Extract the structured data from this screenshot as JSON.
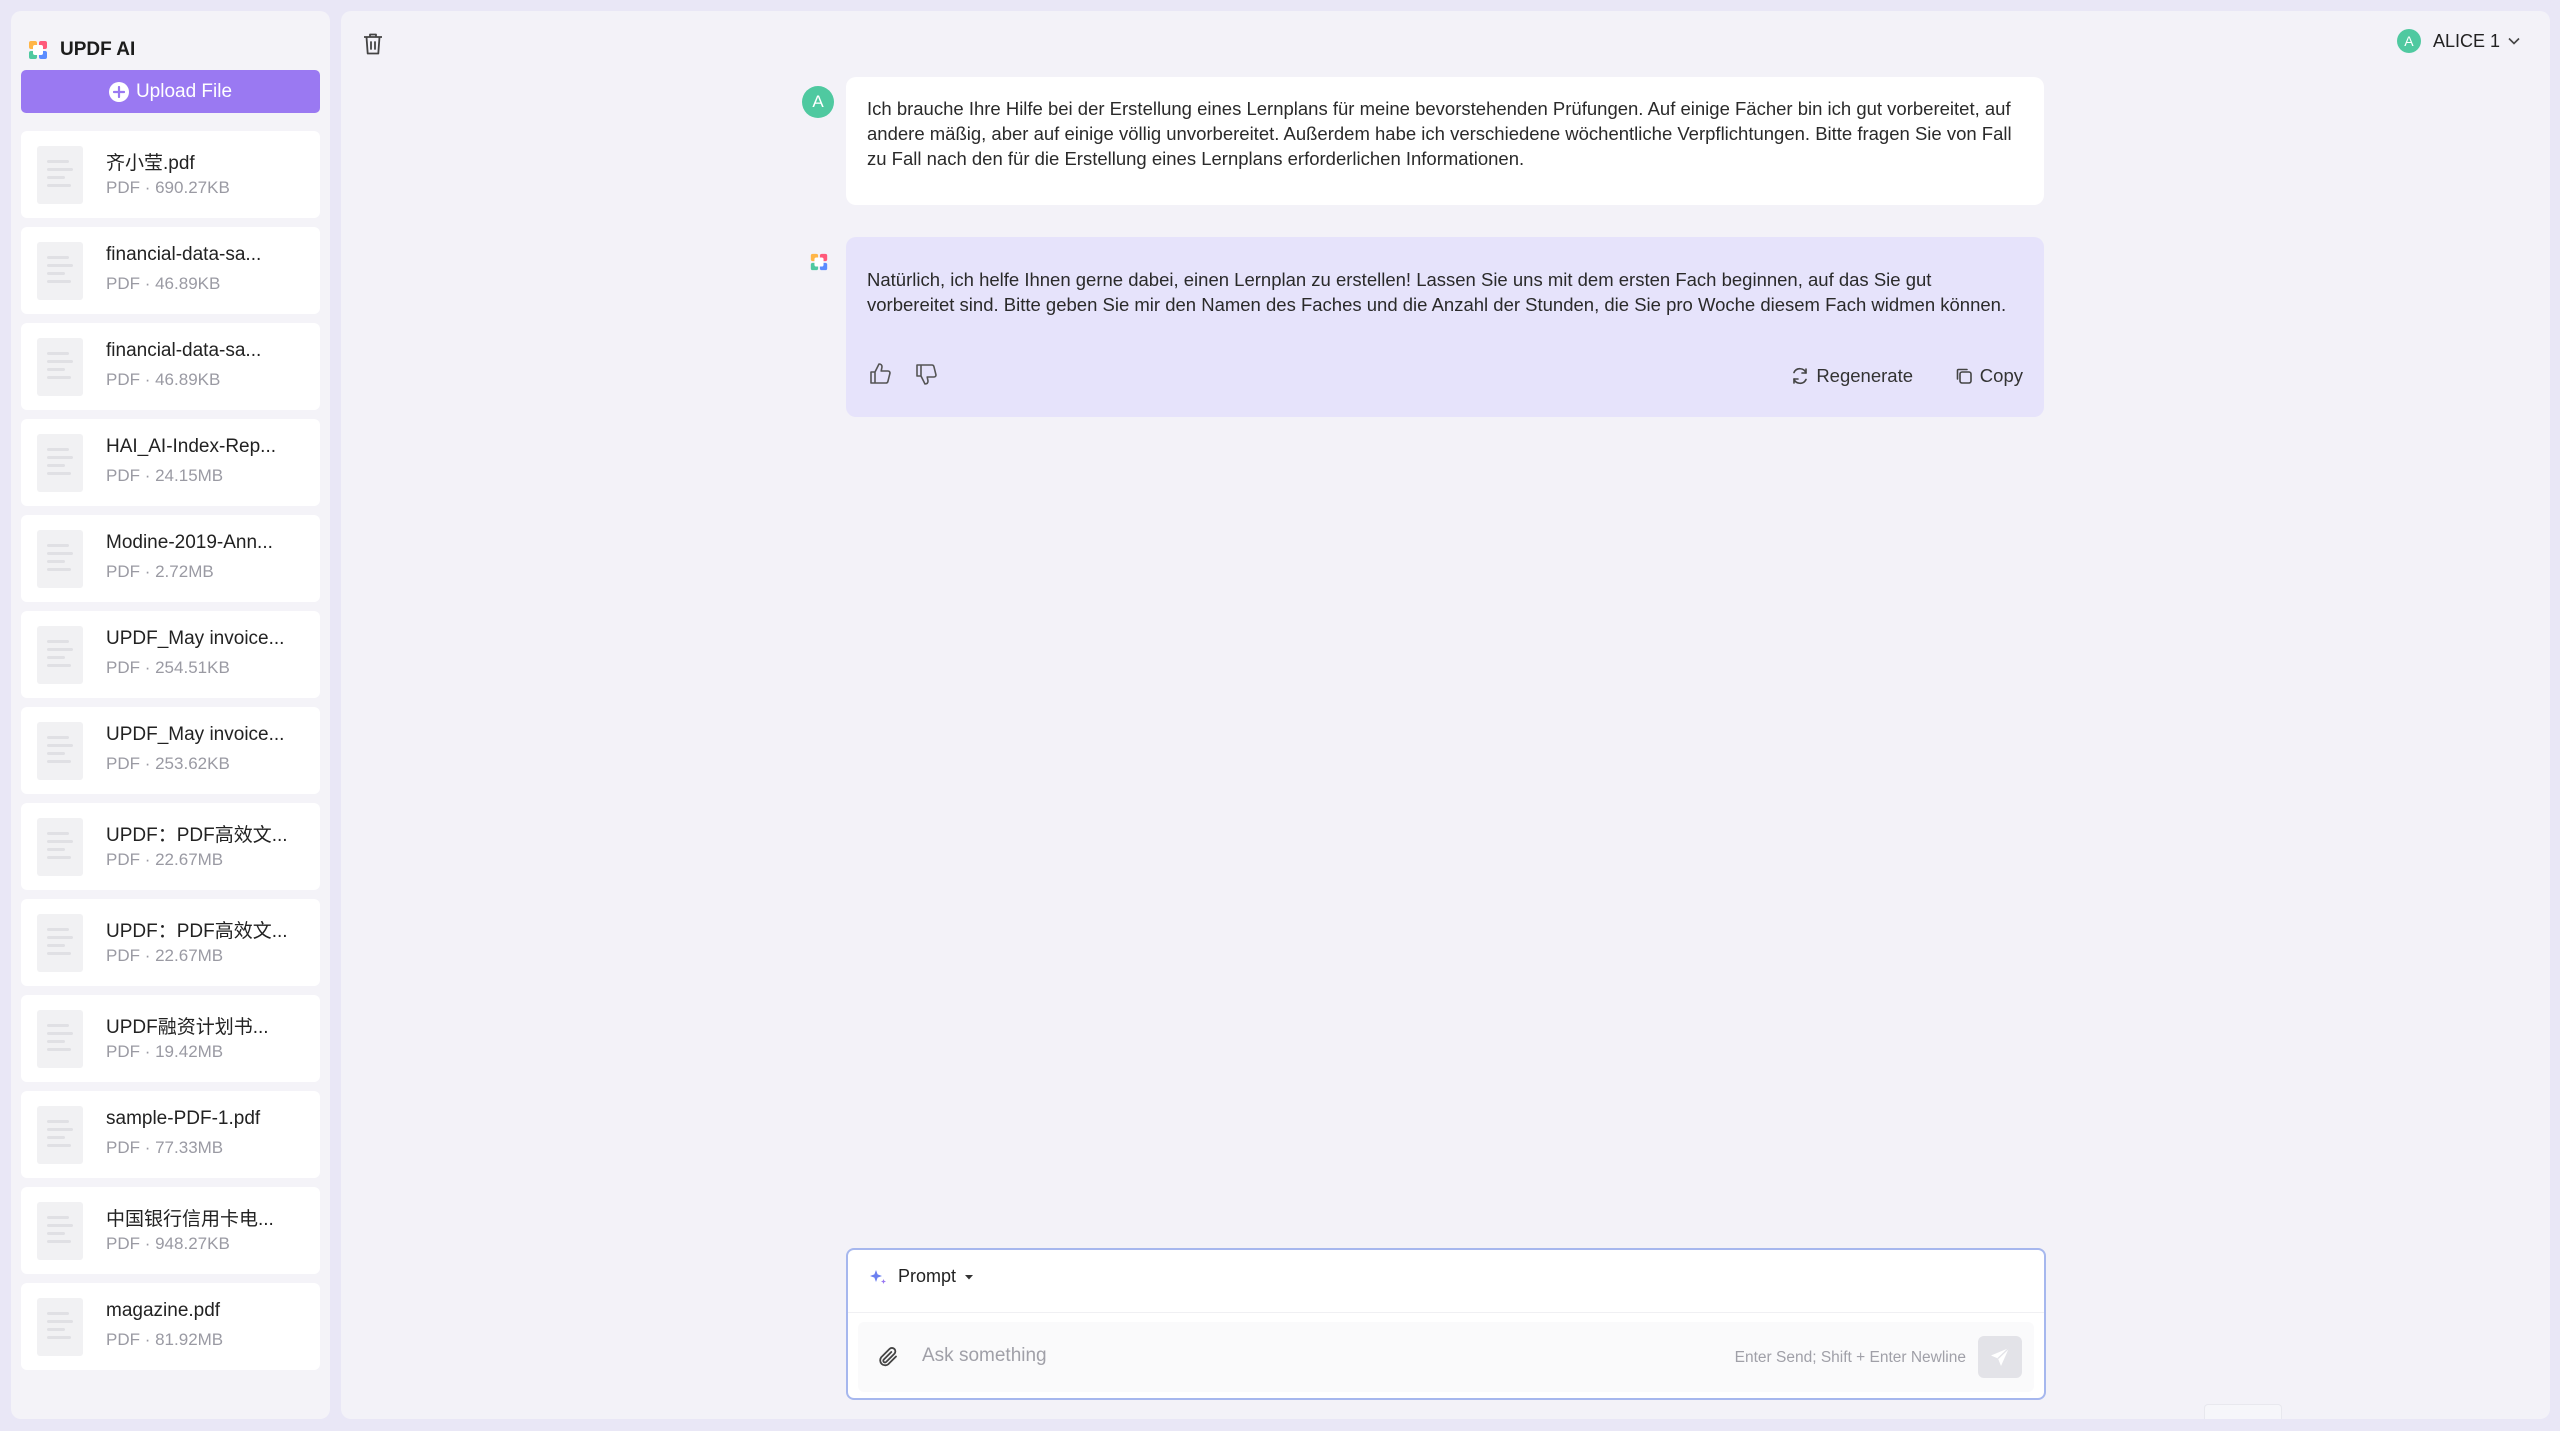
{
  "app": {
    "name": "UPDF AI"
  },
  "sidebar": {
    "upload_label": "Upload File",
    "files": [
      {
        "name": "齐小莹.pdf",
        "meta": "PDF · 690.27KB"
      },
      {
        "name": "financial-data-sa...",
        "meta": "PDF · 46.89KB"
      },
      {
        "name": "financial-data-sa...",
        "meta": "PDF · 46.89KB"
      },
      {
        "name": "HAI_AI-Index-Rep...",
        "meta": "PDF · 24.15MB"
      },
      {
        "name": "Modine-2019-Ann...",
        "meta": "PDF · 2.72MB"
      },
      {
        "name": "UPDF_May invoice...",
        "meta": "PDF · 254.51KB"
      },
      {
        "name": "UPDF_May invoice...",
        "meta": "PDF · 253.62KB"
      },
      {
        "name": "UPDF：PDF高效文...",
        "meta": "PDF · 22.67MB"
      },
      {
        "name": "UPDF：PDF高效文...",
        "meta": "PDF · 22.67MB"
      },
      {
        "name": "UPDF融资计划书...",
        "meta": "PDF · 19.42MB"
      },
      {
        "name": "sample-PDF-1.pdf",
        "meta": "PDF · 77.33MB"
      },
      {
        "name": "中国银行信用卡电...",
        "meta": "PDF · 948.27KB"
      },
      {
        "name": "magazine.pdf",
        "meta": "PDF · 81.92MB"
      }
    ]
  },
  "header": {
    "user_initial": "A",
    "user_name": "ALICE 1"
  },
  "chat": {
    "user_initial": "A",
    "user_message": "Ich brauche Ihre Hilfe bei der Erstellung eines Lernplans für meine bevorstehenden Prüfungen. Auf einige Fächer bin ich gut vorbereitet, auf andere mäßig, aber auf einige völlig unvorbereitet. Außerdem habe ich verschiedene wöchentliche Verpflichtungen. Bitte fragen Sie von Fall zu Fall nach den für die Erstellung eines Lernplans erforderlichen Informationen.",
    "ai_message": "Natürlich, ich helfe Ihnen gerne dabei, einen Lernplan zu erstellen! Lassen Sie uns mit dem ersten Fach beginnen, auf das Sie gut vorbereitet sind. Bitte geben Sie mir den Namen des Faches und die Anzahl der Stunden, die Sie pro Woche diesem Fach widmen können.",
    "regenerate_label": "Regenerate",
    "copy_label": "Copy"
  },
  "composer": {
    "prompt_label": "Prompt",
    "placeholder": "Ask something",
    "hint": "Enter Send; Shift + Enter Newline"
  },
  "colors": {
    "accent": "#9a79f2",
    "ai_bubble": "#e6e3fb",
    "avatar": "#4fc9a0"
  }
}
